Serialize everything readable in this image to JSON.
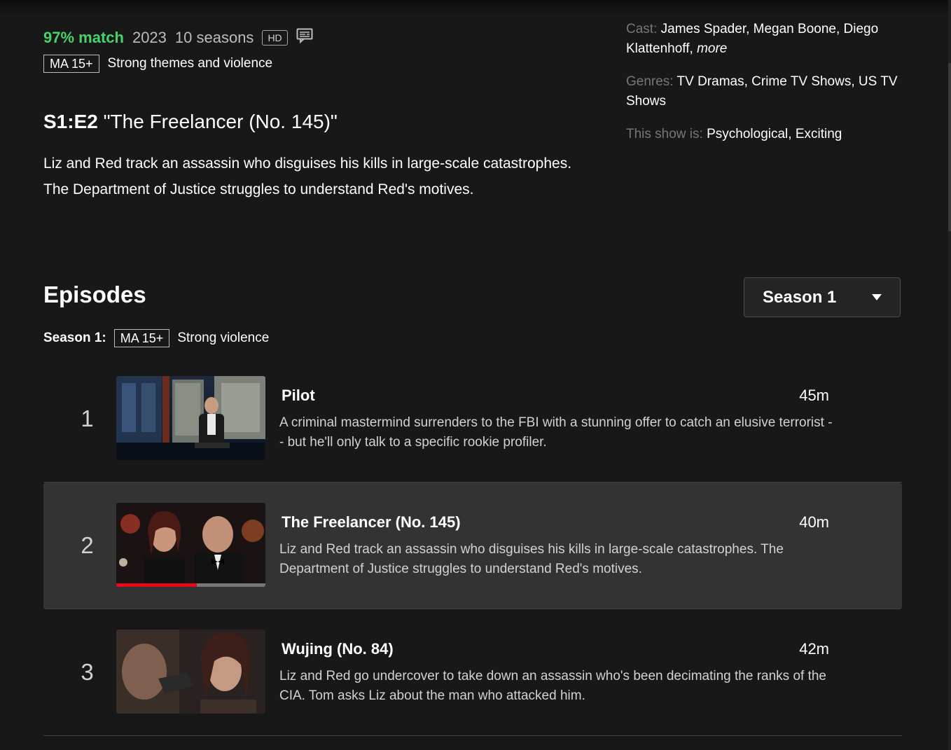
{
  "header": {
    "match": "97% match",
    "year": "2023",
    "seasons": "10 seasons",
    "quality_badge": "HD",
    "subtitles_icon": "subtitles-icon",
    "maturity_rating": "MA 15+",
    "maturity_reason": "Strong themes and violence"
  },
  "current_episode": {
    "code": "S1:E2",
    "title": "\"The Freelancer (No. 145)\"",
    "synopsis": "Liz and Red track an assassin who disguises his kills in large-scale catastrophes. The Department of Justice struggles to understand Red's motives."
  },
  "details": {
    "cast_label": "Cast:",
    "cast_value": "James Spader, Megan Boone, Diego Klattenhoff,",
    "cast_more": "more",
    "genres_label": "Genres:",
    "genres_value": "TV Dramas, Crime TV Shows, US TV Shows",
    "tags_label": "This show is:",
    "tags_value": "Psychological, Exciting"
  },
  "episodes_section": {
    "heading": "Episodes",
    "season_selector": "Season 1",
    "season_label": "Season 1:",
    "season_rating": "MA 15+",
    "season_reason": "Strong violence"
  },
  "episodes": [
    {
      "number": "1",
      "title": "Pilot",
      "duration": "45m",
      "description": "A criminal mastermind surrenders to the FBI with a stunning offer to catch an elusive terrorist -- but he'll only talk to a specific rookie profiler."
    },
    {
      "number": "2",
      "title": "The Freelancer (No. 145)",
      "duration": "40m",
      "description": "Liz and Red track an assassin who disguises his kills in large-scale catastrophes. The Department of Justice struggles to understand Red's motives.",
      "progress": 0.54
    },
    {
      "number": "3",
      "title": "Wujing (No. 84)",
      "duration": "42m",
      "description": "Liz and Red go undercover to take down an assassin who's been decimating the ranks of the CIA. Tom asks Liz about the man who attacked him."
    }
  ],
  "colors": {
    "match_green": "#46d369",
    "progress_red": "#e50914",
    "background": "#181818",
    "active_row": "#333333"
  }
}
